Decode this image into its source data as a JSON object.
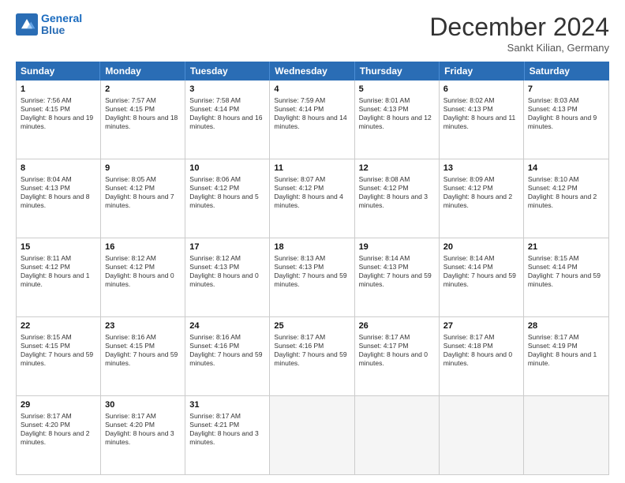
{
  "header": {
    "logo_line1": "General",
    "logo_line2": "Blue",
    "month_title": "December 2024",
    "subtitle": "Sankt Kilian, Germany"
  },
  "days_of_week": [
    "Sunday",
    "Monday",
    "Tuesday",
    "Wednesday",
    "Thursday",
    "Friday",
    "Saturday"
  ],
  "weeks": [
    [
      {
        "day": "1",
        "info": "Sunrise: 7:56 AM\nSunset: 4:15 PM\nDaylight: 8 hours and 19 minutes."
      },
      {
        "day": "2",
        "info": "Sunrise: 7:57 AM\nSunset: 4:15 PM\nDaylight: 8 hours and 18 minutes."
      },
      {
        "day": "3",
        "info": "Sunrise: 7:58 AM\nSunset: 4:14 PM\nDaylight: 8 hours and 16 minutes."
      },
      {
        "day": "4",
        "info": "Sunrise: 7:59 AM\nSunset: 4:14 PM\nDaylight: 8 hours and 14 minutes."
      },
      {
        "day": "5",
        "info": "Sunrise: 8:01 AM\nSunset: 4:13 PM\nDaylight: 8 hours and 12 minutes."
      },
      {
        "day": "6",
        "info": "Sunrise: 8:02 AM\nSunset: 4:13 PM\nDaylight: 8 hours and 11 minutes."
      },
      {
        "day": "7",
        "info": "Sunrise: 8:03 AM\nSunset: 4:13 PM\nDaylight: 8 hours and 9 minutes."
      }
    ],
    [
      {
        "day": "8",
        "info": "Sunrise: 8:04 AM\nSunset: 4:13 PM\nDaylight: 8 hours and 8 minutes."
      },
      {
        "day": "9",
        "info": "Sunrise: 8:05 AM\nSunset: 4:12 PM\nDaylight: 8 hours and 7 minutes."
      },
      {
        "day": "10",
        "info": "Sunrise: 8:06 AM\nSunset: 4:12 PM\nDaylight: 8 hours and 5 minutes."
      },
      {
        "day": "11",
        "info": "Sunrise: 8:07 AM\nSunset: 4:12 PM\nDaylight: 8 hours and 4 minutes."
      },
      {
        "day": "12",
        "info": "Sunrise: 8:08 AM\nSunset: 4:12 PM\nDaylight: 8 hours and 3 minutes."
      },
      {
        "day": "13",
        "info": "Sunrise: 8:09 AM\nSunset: 4:12 PM\nDaylight: 8 hours and 2 minutes."
      },
      {
        "day": "14",
        "info": "Sunrise: 8:10 AM\nSunset: 4:12 PM\nDaylight: 8 hours and 2 minutes."
      }
    ],
    [
      {
        "day": "15",
        "info": "Sunrise: 8:11 AM\nSunset: 4:12 PM\nDaylight: 8 hours and 1 minute."
      },
      {
        "day": "16",
        "info": "Sunrise: 8:12 AM\nSunset: 4:12 PM\nDaylight: 8 hours and 0 minutes."
      },
      {
        "day": "17",
        "info": "Sunrise: 8:12 AM\nSunset: 4:13 PM\nDaylight: 8 hours and 0 minutes."
      },
      {
        "day": "18",
        "info": "Sunrise: 8:13 AM\nSunset: 4:13 PM\nDaylight: 7 hours and 59 minutes."
      },
      {
        "day": "19",
        "info": "Sunrise: 8:14 AM\nSunset: 4:13 PM\nDaylight: 7 hours and 59 minutes."
      },
      {
        "day": "20",
        "info": "Sunrise: 8:14 AM\nSunset: 4:14 PM\nDaylight: 7 hours and 59 minutes."
      },
      {
        "day": "21",
        "info": "Sunrise: 8:15 AM\nSunset: 4:14 PM\nDaylight: 7 hours and 59 minutes."
      }
    ],
    [
      {
        "day": "22",
        "info": "Sunrise: 8:15 AM\nSunset: 4:15 PM\nDaylight: 7 hours and 59 minutes."
      },
      {
        "day": "23",
        "info": "Sunrise: 8:16 AM\nSunset: 4:15 PM\nDaylight: 7 hours and 59 minutes."
      },
      {
        "day": "24",
        "info": "Sunrise: 8:16 AM\nSunset: 4:16 PM\nDaylight: 7 hours and 59 minutes."
      },
      {
        "day": "25",
        "info": "Sunrise: 8:17 AM\nSunset: 4:16 PM\nDaylight: 7 hours and 59 minutes."
      },
      {
        "day": "26",
        "info": "Sunrise: 8:17 AM\nSunset: 4:17 PM\nDaylight: 8 hours and 0 minutes."
      },
      {
        "day": "27",
        "info": "Sunrise: 8:17 AM\nSunset: 4:18 PM\nDaylight: 8 hours and 0 minutes."
      },
      {
        "day": "28",
        "info": "Sunrise: 8:17 AM\nSunset: 4:19 PM\nDaylight: 8 hours and 1 minute."
      }
    ],
    [
      {
        "day": "29",
        "info": "Sunrise: 8:17 AM\nSunset: 4:20 PM\nDaylight: 8 hours and 2 minutes."
      },
      {
        "day": "30",
        "info": "Sunrise: 8:17 AM\nSunset: 4:20 PM\nDaylight: 8 hours and 3 minutes."
      },
      {
        "day": "31",
        "info": "Sunrise: 8:17 AM\nSunset: 4:21 PM\nDaylight: 8 hours and 3 minutes."
      },
      {
        "day": "",
        "info": ""
      },
      {
        "day": "",
        "info": ""
      },
      {
        "day": "",
        "info": ""
      },
      {
        "day": "",
        "info": ""
      }
    ]
  ]
}
